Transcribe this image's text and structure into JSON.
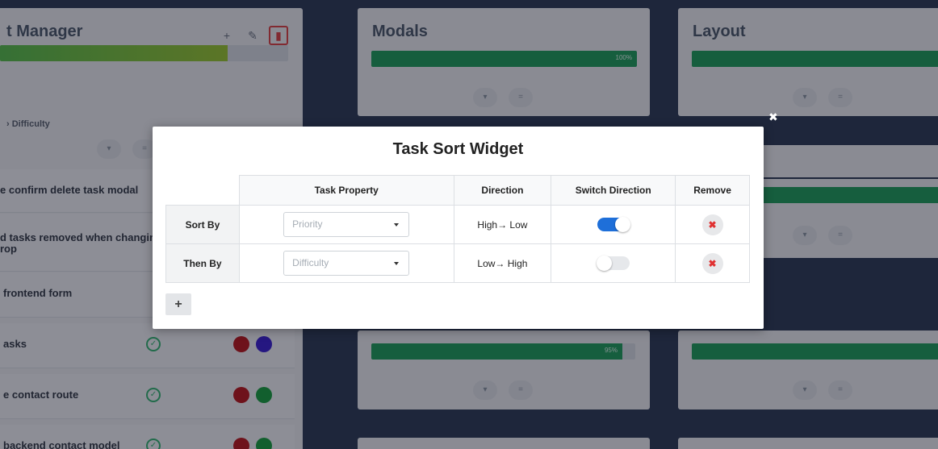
{
  "background": {
    "project_panel": {
      "title": "t Manager",
      "header_icons": [
        "plus-icon",
        "edit-icon",
        "trash-icon"
      ],
      "progress": {
        "percent": 0.79,
        "label": ""
      },
      "breadcrumb": "›  Difficulty",
      "tasks": [
        {
          "label": "e confirm delete task modal"
        },
        {
          "label": "d tasks removed when changing s",
          "label2": "rop"
        },
        {
          "label": "frontend form"
        },
        {
          "label": "asks",
          "dots": [
            "#c0171a",
            "#3b1fd4"
          ]
        },
        {
          "label": "e contact route",
          "dots": [
            "#c0171a",
            "#19a33c"
          ]
        },
        {
          "label": "backend contact model",
          "dots": [
            "#c0171a",
            "#19a33c"
          ]
        }
      ]
    },
    "modals_panel": {
      "title": "Modals",
      "progress": {
        "percent": 1.0,
        "label": "100%"
      },
      "progress2": {
        "percent": 0.95,
        "label": "95%"
      }
    },
    "layout_panel": {
      "title": "Layout"
    }
  },
  "modal": {
    "title": "Task Sort Widget",
    "columns": {
      "property": "Task Property",
      "direction": "Direction",
      "switch": "Switch Direction",
      "remove": "Remove"
    },
    "rows": [
      {
        "label": "Sort By",
        "property_placeholder": "Priority",
        "direction": "High→ Low",
        "switch_on": true
      },
      {
        "label": "Then By",
        "property_placeholder": "Difficulty",
        "direction": "Low→ High",
        "switch_on": false
      }
    ],
    "add_label": "+",
    "remove_label": "✖"
  },
  "colors": {
    "accent_blue": "#1e6fd9",
    "danger_red": "#e03131",
    "success_green": "#1fa05a"
  }
}
